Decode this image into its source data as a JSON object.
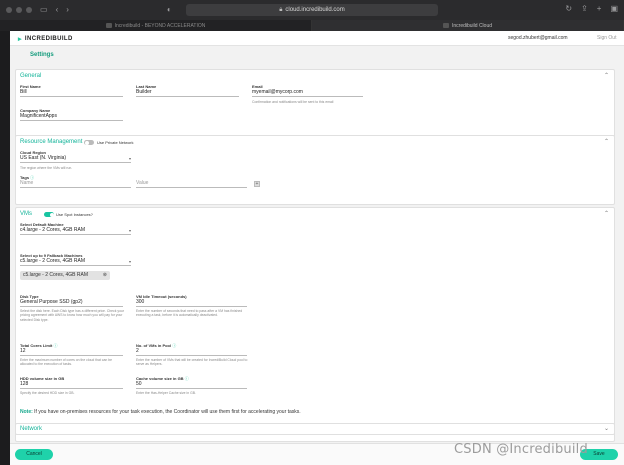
{
  "browser": {
    "url": "cloud.incredibuild.com",
    "tabs": [
      {
        "label": "Incredibuild - BEYOND ACCELERATION"
      },
      {
        "label": "Incredibuild Cloud"
      }
    ]
  },
  "header": {
    "logo": "INCREDIBUILD",
    "user_email": "segod.zhubert@gmail.com",
    "sign_out": "Sign Out"
  },
  "page_title": "Settings",
  "general": {
    "title": "General",
    "first_name_label": "First Name",
    "first_name": "Bill",
    "last_name_label": "Last Name",
    "last_name": "Builder",
    "email_label": "Email",
    "email": "myemail@mycorp.com",
    "email_hint": "Confirmation and notifications will be sent to this email",
    "company_label": "Company Name",
    "company": "MagnificentApps"
  },
  "resource": {
    "title": "Resource Management",
    "private_network_label": "Use Private Network",
    "private_network_on": false,
    "region_label": "Cloud Region",
    "region": "US East (N. Virginia)",
    "region_hint": "The region where the VMs will run.",
    "tags_label": "Tags",
    "tag_name_placeholder": "Name",
    "tag_value_placeholder": "Value"
  },
  "vms": {
    "title": "VMs",
    "spot_label": "Use Spot Instances?",
    "spot_on": true,
    "default_machine_label": "Select Default Machine",
    "default_machine": "c4.large - 2 Cores, 4GB RAM",
    "fallback_label": "Select up to 9 Fallback Machines",
    "fallback_machine": "c5.large - 2 Cores, 4GB RAM",
    "fallback_chip": "c5.large - 2 Cores, 4GB RAM",
    "disk_label": "Disk Type",
    "disk": "General Purpose SSD (gp2)",
    "disk_hint": "Select the disk here. Each Disk type has a different price. Check your pricing agreement with AWS to know how much you will pay for your selected Disk type.",
    "idle_label": "VM Idle Timeout (seconds)",
    "idle": "300",
    "idle_hint": "Enter the number of seconds that need to pass after a VM has finished executing a task, before it is automatically deactivated.",
    "cores_label": "Total Cores Limit",
    "cores": "12",
    "cores_hint": "Enter the maximum number of cores on the cloud that can be allocated to the execution of tasks.",
    "pool_label": "No. of VMs in Pool",
    "pool": "2",
    "pool_hint": "Enter the number of VMs that will be created for IncrediBuild Cloud pool to serve as Helpers.",
    "hdd_label": "HDD volume size in GB",
    "hdd": "128",
    "hdd_hint": "Specify the desired HDD size in GB.",
    "cache_label": "Cache volume size in GB",
    "cache": "50",
    "cache_hint": "Enter the Has-Helper Cache size in GB.",
    "note_prefix": "Note:",
    "note_text": " If you have on-premises resources for your task execution, the Coordinator will use them first for accelerating your tasks."
  },
  "network": {
    "title": "Network"
  },
  "footer": {
    "cancel": "Cancel",
    "save": "Save"
  },
  "watermark": "CSDN @Incredibuild",
  "colors": {
    "accent": "#1fd2aa",
    "section_title": "#14b49a"
  }
}
